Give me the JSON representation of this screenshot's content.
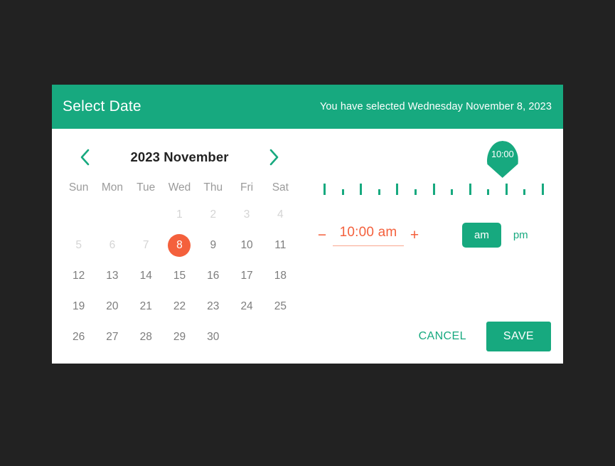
{
  "theme": {
    "accent_green": "#17a97f",
    "accent_orange": "#f4603c",
    "backdrop": "#222222",
    "surface": "#ffffff"
  },
  "dialog": {
    "header": {
      "title": "Select Date",
      "selection_summary": "You have selected Wednesday November 8, 2023"
    },
    "calendar": {
      "prev_icon": "chevron-left-icon",
      "next_icon": "chevron-right-icon",
      "month_label": "2023 November",
      "weekdays": [
        "Sun",
        "Mon",
        "Tue",
        "Wed",
        "Thu",
        "Fri",
        "Sat"
      ],
      "leading_blanks": 3,
      "days": [
        {
          "label": "1",
          "state": "disabled"
        },
        {
          "label": "2",
          "state": "disabled"
        },
        {
          "label": "3",
          "state": "disabled"
        },
        {
          "label": "4",
          "state": "disabled"
        },
        {
          "label": "5",
          "state": "disabled"
        },
        {
          "label": "6",
          "state": "disabled"
        },
        {
          "label": "7",
          "state": "disabled"
        },
        {
          "label": "8",
          "state": "selected"
        },
        {
          "label": "9",
          "state": "enabled"
        },
        {
          "label": "10",
          "state": "enabled"
        },
        {
          "label": "11",
          "state": "enabled"
        },
        {
          "label": "12",
          "state": "enabled"
        },
        {
          "label": "13",
          "state": "enabled"
        },
        {
          "label": "14",
          "state": "enabled"
        },
        {
          "label": "15",
          "state": "enabled"
        },
        {
          "label": "16",
          "state": "enabled"
        },
        {
          "label": "17",
          "state": "enabled"
        },
        {
          "label": "18",
          "state": "enabled"
        },
        {
          "label": "19",
          "state": "enabled"
        },
        {
          "label": "20",
          "state": "enabled"
        },
        {
          "label": "21",
          "state": "enabled"
        },
        {
          "label": "22",
          "state": "enabled"
        },
        {
          "label": "23",
          "state": "enabled"
        },
        {
          "label": "24",
          "state": "enabled"
        },
        {
          "label": "25",
          "state": "enabled"
        },
        {
          "label": "26",
          "state": "enabled"
        },
        {
          "label": "27",
          "state": "enabled"
        },
        {
          "label": "28",
          "state": "enabled"
        },
        {
          "label": "29",
          "state": "enabled"
        },
        {
          "label": "30",
          "state": "enabled"
        }
      ]
    },
    "time": {
      "slider": {
        "thumb_label": "10:00",
        "thumb_percent": 82,
        "tick_count": 13
      },
      "decrement_label": "−",
      "increment_label": "+",
      "value": "10:00 am",
      "placeholder": "10:00 am",
      "meridiem": {
        "am_label": "am",
        "pm_label": "pm",
        "selected": "am"
      }
    },
    "footer": {
      "cancel_label": "CANCEL",
      "save_label": "SAVE"
    }
  }
}
